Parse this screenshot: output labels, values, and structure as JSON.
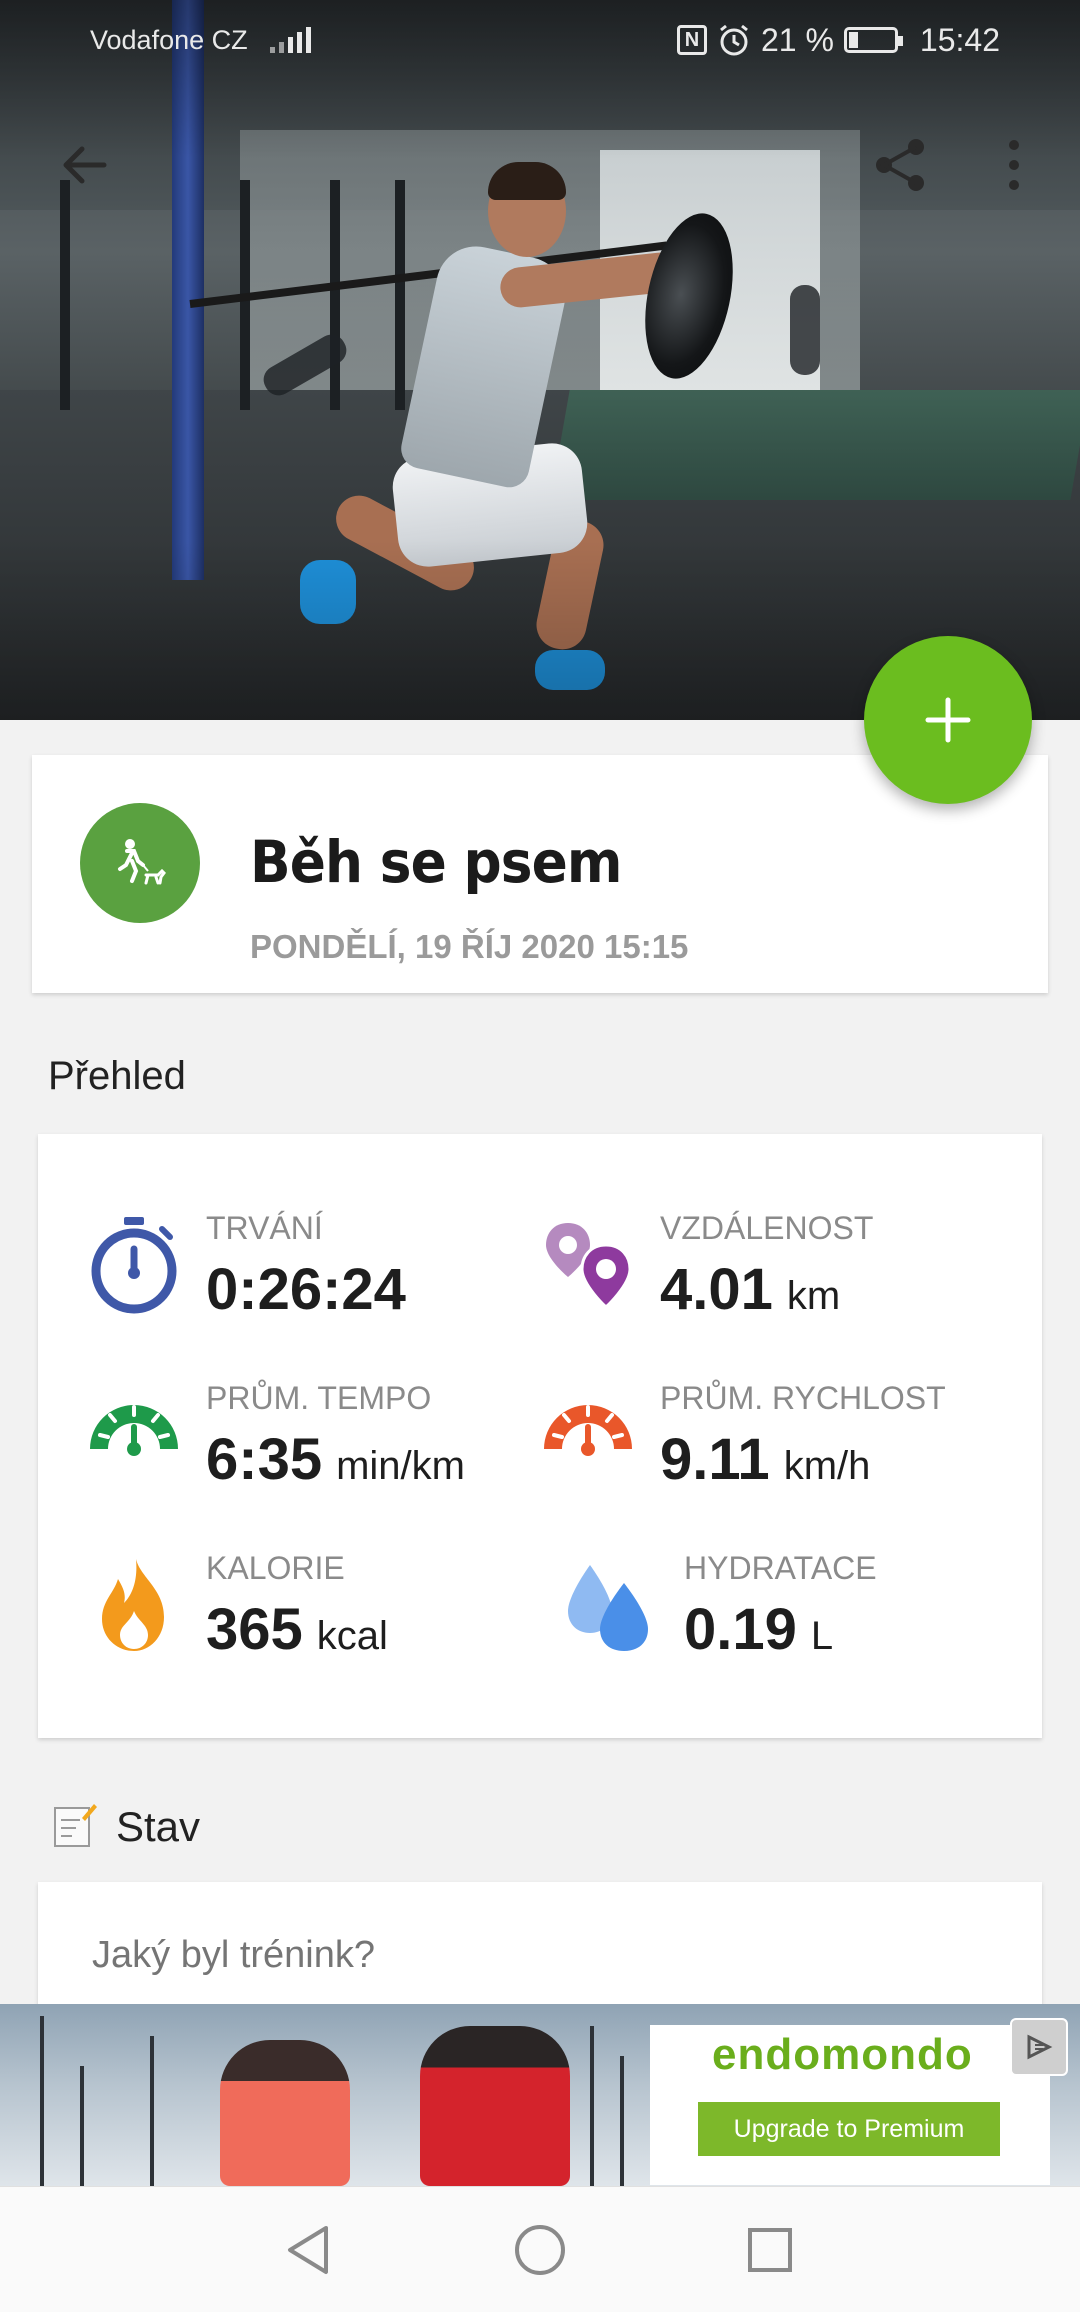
{
  "status_bar": {
    "carrier": "Vodafone CZ",
    "battery_percent": "21 %",
    "battery_level": 0.21,
    "time": "15:42"
  },
  "toolbar": {
    "back_icon": "back-arrow-icon",
    "share_icon": "share-icon",
    "more_icon": "more-vert-icon"
  },
  "fab": {
    "icon": "plus-icon",
    "color": "#6bbd1f"
  },
  "workout": {
    "sport_icon": "dog-walk-run-icon",
    "title": "Běh se psem",
    "date": "PONDĚLÍ, 19 ŘÍJ 2020 15:15"
  },
  "overview": {
    "heading": "Přehled",
    "stats": {
      "duration": {
        "label": "TRVÁNÍ",
        "value": "0:26:24",
        "unit": "",
        "icon": "stopwatch-icon",
        "color": "#3f58a8"
      },
      "distance": {
        "label": "VZDÁLENOST",
        "value": "4.01",
        "unit": "km",
        "icon": "location-pins-icon",
        "color": "#8e3a9e"
      },
      "pace": {
        "label": "PRŮM. TEMPO",
        "value": "6:35",
        "unit": "min/km",
        "icon": "gauge-green-icon",
        "color": "#1e9a4a"
      },
      "speed": {
        "label": "PRŮM. RYCHLOST",
        "value": "9.11",
        "unit": "km/h",
        "icon": "gauge-orange-icon",
        "color": "#e9572a"
      },
      "calories": {
        "label": "KALORIE",
        "value": "365",
        "unit": "kcal",
        "icon": "flame-icon",
        "color": "#f39a1c"
      },
      "hydration": {
        "label": "HYDRATACE",
        "value": "0.19",
        "unit": "L",
        "icon": "water-drops-icon",
        "color": "#4a8fe8"
      }
    }
  },
  "status_section": {
    "heading": "Stav",
    "icon": "note-pencil-icon",
    "placeholder": "Jaký byl trénink?"
  },
  "ad": {
    "logo": "endomondo",
    "button": "Upgrade to Premium",
    "close_icon": "ad-choices-icon"
  },
  "navbar": {
    "back_icon": "nav-back-icon",
    "home_icon": "nav-home-icon",
    "recents_icon": "nav-recents-icon"
  }
}
